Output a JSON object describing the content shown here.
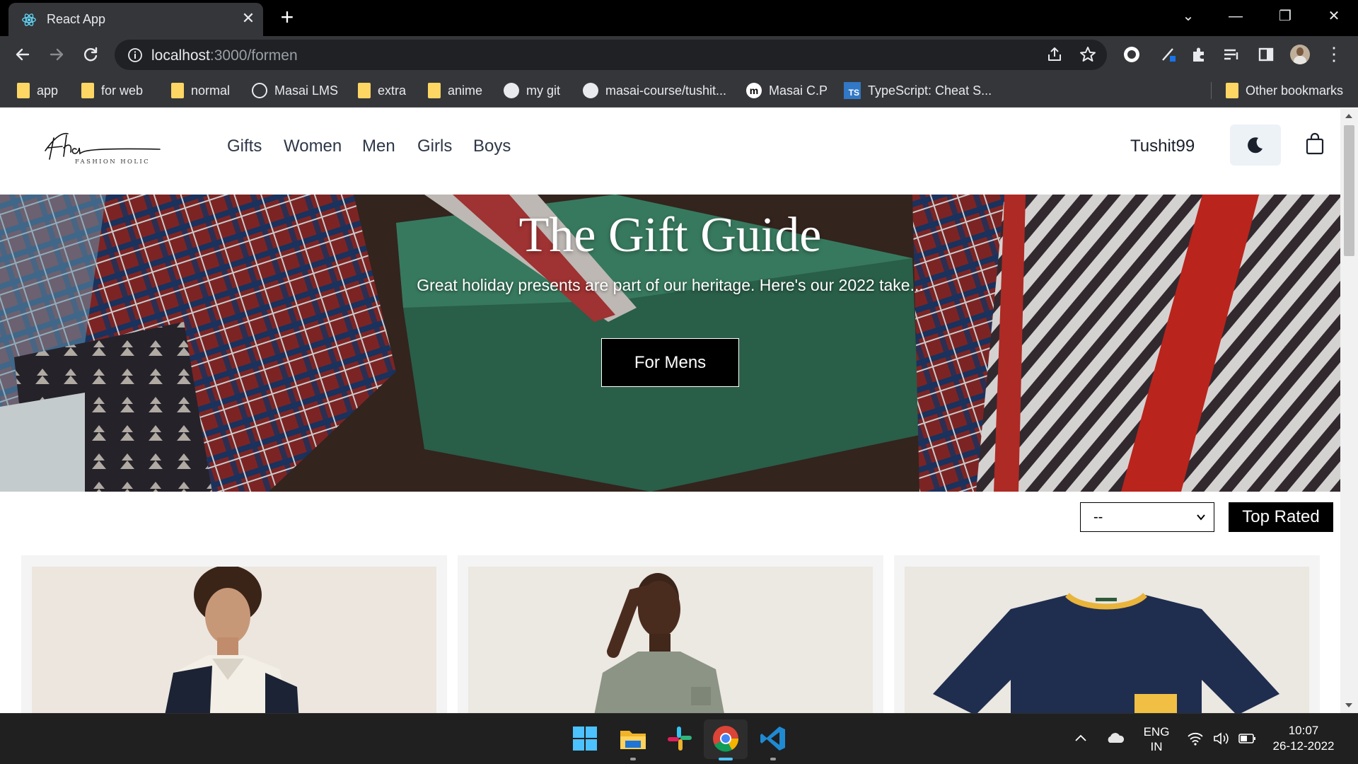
{
  "browser": {
    "tab_title": "React App",
    "url_host": "localhost",
    "url_path": ":3000/formen",
    "bookmarks": [
      {
        "label": "app",
        "icon": "folder-icon"
      },
      {
        "label": "for web",
        "icon": "folder-icon"
      },
      {
        "label": "normal",
        "icon": "folder-icon"
      },
      {
        "label": "Masai LMS",
        "icon": "globe-icon"
      },
      {
        "label": "extra",
        "icon": "folder-icon"
      },
      {
        "label": "anime",
        "icon": "folder-icon"
      },
      {
        "label": "my git",
        "icon": "github-icon"
      },
      {
        "label": "masai-course/tushit...",
        "icon": "github-icon"
      },
      {
        "label": "Masai C.P",
        "icon": "masai-icon"
      },
      {
        "label": "TypeScript: Cheat S...",
        "icon": "typescript-icon"
      }
    ],
    "other_bookmarks": "Other bookmarks",
    "ts_badge": "TS"
  },
  "site": {
    "logo_script": "Fha",
    "logo_tagline": "FASHION HOLIC",
    "nav": [
      "Gifts",
      "Women",
      "Men",
      "Girls",
      "Boys"
    ],
    "username": "Tushit99"
  },
  "hero": {
    "title": "The Gift Guide",
    "subtitle": "Great holiday presents are part of our heritage. Here's our 2022 take...",
    "cta": "For Mens"
  },
  "filters": {
    "sort_value": "--",
    "top_rated": "Top Rated"
  },
  "taskbar": {
    "lang_top": "ENG",
    "lang_bottom": "IN",
    "time": "10:07",
    "date": "26-12-2022"
  },
  "colors": {
    "accent_black": "#000000",
    "chrome_dark": "#35363a",
    "folder_yellow": "#fdd663"
  }
}
